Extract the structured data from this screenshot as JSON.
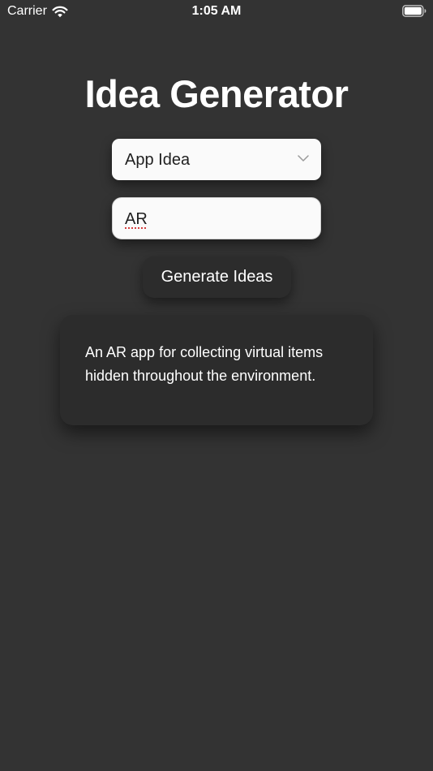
{
  "status_bar": {
    "carrier": "Carrier",
    "time": "1:05 AM",
    "wifi_icon": "wifi-icon",
    "battery_icon": "battery-full-icon"
  },
  "title": "Idea Generator",
  "category_select": {
    "selected": "App Idea",
    "icon": "chevron-down-icon"
  },
  "topic_input": {
    "value": "AR"
  },
  "generate_button": {
    "label": "Generate Ideas"
  },
  "result": {
    "text": "An AR app for collecting virtual items hidden throughout the environment."
  },
  "colors": {
    "background": "#333333",
    "card": "#2c2c2c",
    "field": "#fafafa",
    "text_light": "#ffffff",
    "text_dark": "#1f1f1f"
  }
}
